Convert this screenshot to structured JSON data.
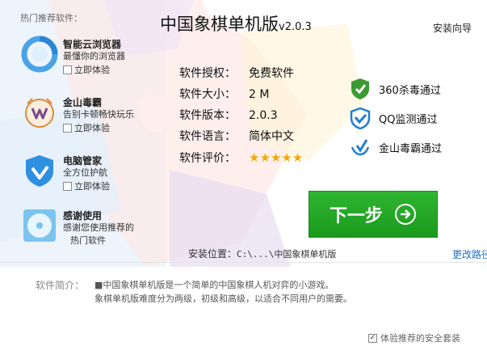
{
  "sidebar": {
    "title": "热门推荐软件：",
    "items": [
      {
        "name": "智能云浏览器",
        "desc": "最懂你的浏览器",
        "check_label": "立即体验",
        "icon": "browser-icon"
      },
      {
        "name": "金山毒霸",
        "desc": "告别卡顿畅快玩乐",
        "check_label": "立即体验",
        "icon": "antivirus-icon"
      },
      {
        "name": "电脑管家",
        "desc": "全方位护航",
        "check_label": "立即体验",
        "icon": "pc-manager-icon"
      },
      {
        "name": "感谢使用",
        "desc": "感谢您使用推荐的",
        "desc2": "热门软件",
        "icon": "disc-icon"
      }
    ]
  },
  "header": {
    "title": "中国象棋单机版",
    "version": "v2.0.3",
    "wizard": "安装向导"
  },
  "info": {
    "license_key": "软件授权：",
    "license_val": "免费软件",
    "size_key": "软件大小：",
    "size_val": "2 M",
    "version_key": "软件版本：",
    "version_val": "2.0.3",
    "lang_key": "软件语言：",
    "lang_val": "简体中文",
    "rating_key": "软件评价：",
    "rating_stars": "★★★★★",
    "rating_value": 5
  },
  "badges": [
    {
      "label": "360杀毒通过",
      "icon": "360-shield-icon"
    },
    {
      "label": "QQ监测通过",
      "icon": "qq-shield-icon"
    },
    {
      "label": "金山毒霸通过",
      "icon": "kingsoft-icon"
    }
  ],
  "next_button": {
    "label": "下一步",
    "icon": "arrow-right-circle-icon"
  },
  "install": {
    "label": "安装位置：",
    "path": "C:\\...\\中国象棋单机版",
    "change": "更改路径"
  },
  "intro": {
    "label": "软件简介：",
    "line1": "■中国象棋单机版是一个简单的中国象棋人机对弈的小游戏。",
    "line2": "象棋单机版难度分为两级，初级和高级，以适合不同用户的需要。"
  },
  "footer": {
    "check_label": "体验推荐的安全套装",
    "checked": true
  },
  "colors": {
    "accent_green": "#1fa521",
    "link_blue": "#1f6fc2",
    "star": "#f2a900"
  }
}
